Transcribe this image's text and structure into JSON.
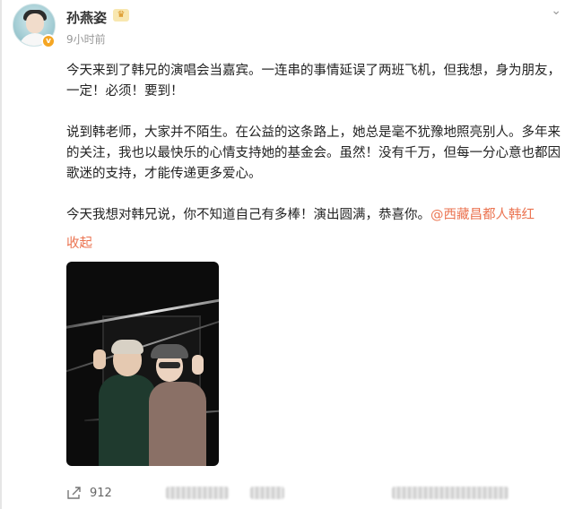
{
  "header": {
    "username": "孙燕姿",
    "time": "9小时前"
  },
  "post": {
    "paragraphs": [
      "今天来到了韩兄的演唱会当嘉宾。一连串的事情延误了两班飞机，但我想，身为朋友，一定！必须！要到！",
      "说到韩老师，大家并不陌生。在公益的这条路上，她总是毫不犹豫地照亮别人。多年来的关注，我也以最快乐的心情支持她的基金会。虽然！没有千万，但每一分心意也都因歌迷的支持，才能传递更多爱心。",
      "今天我想对韩兄说，你不知道自己有多棒！演出圆满，恭喜你。"
    ],
    "mention": "@西藏昌都人韩红",
    "collapse_label": "收起"
  },
  "actions": {
    "share_count": "912"
  },
  "icons": {
    "verified": "verified-badge-icon",
    "crown": "vip-crown-icon",
    "share": "share-icon",
    "menu": "chevron-down-icon"
  },
  "colors": {
    "accent": "#eb7350",
    "verified": "#f5a623"
  }
}
